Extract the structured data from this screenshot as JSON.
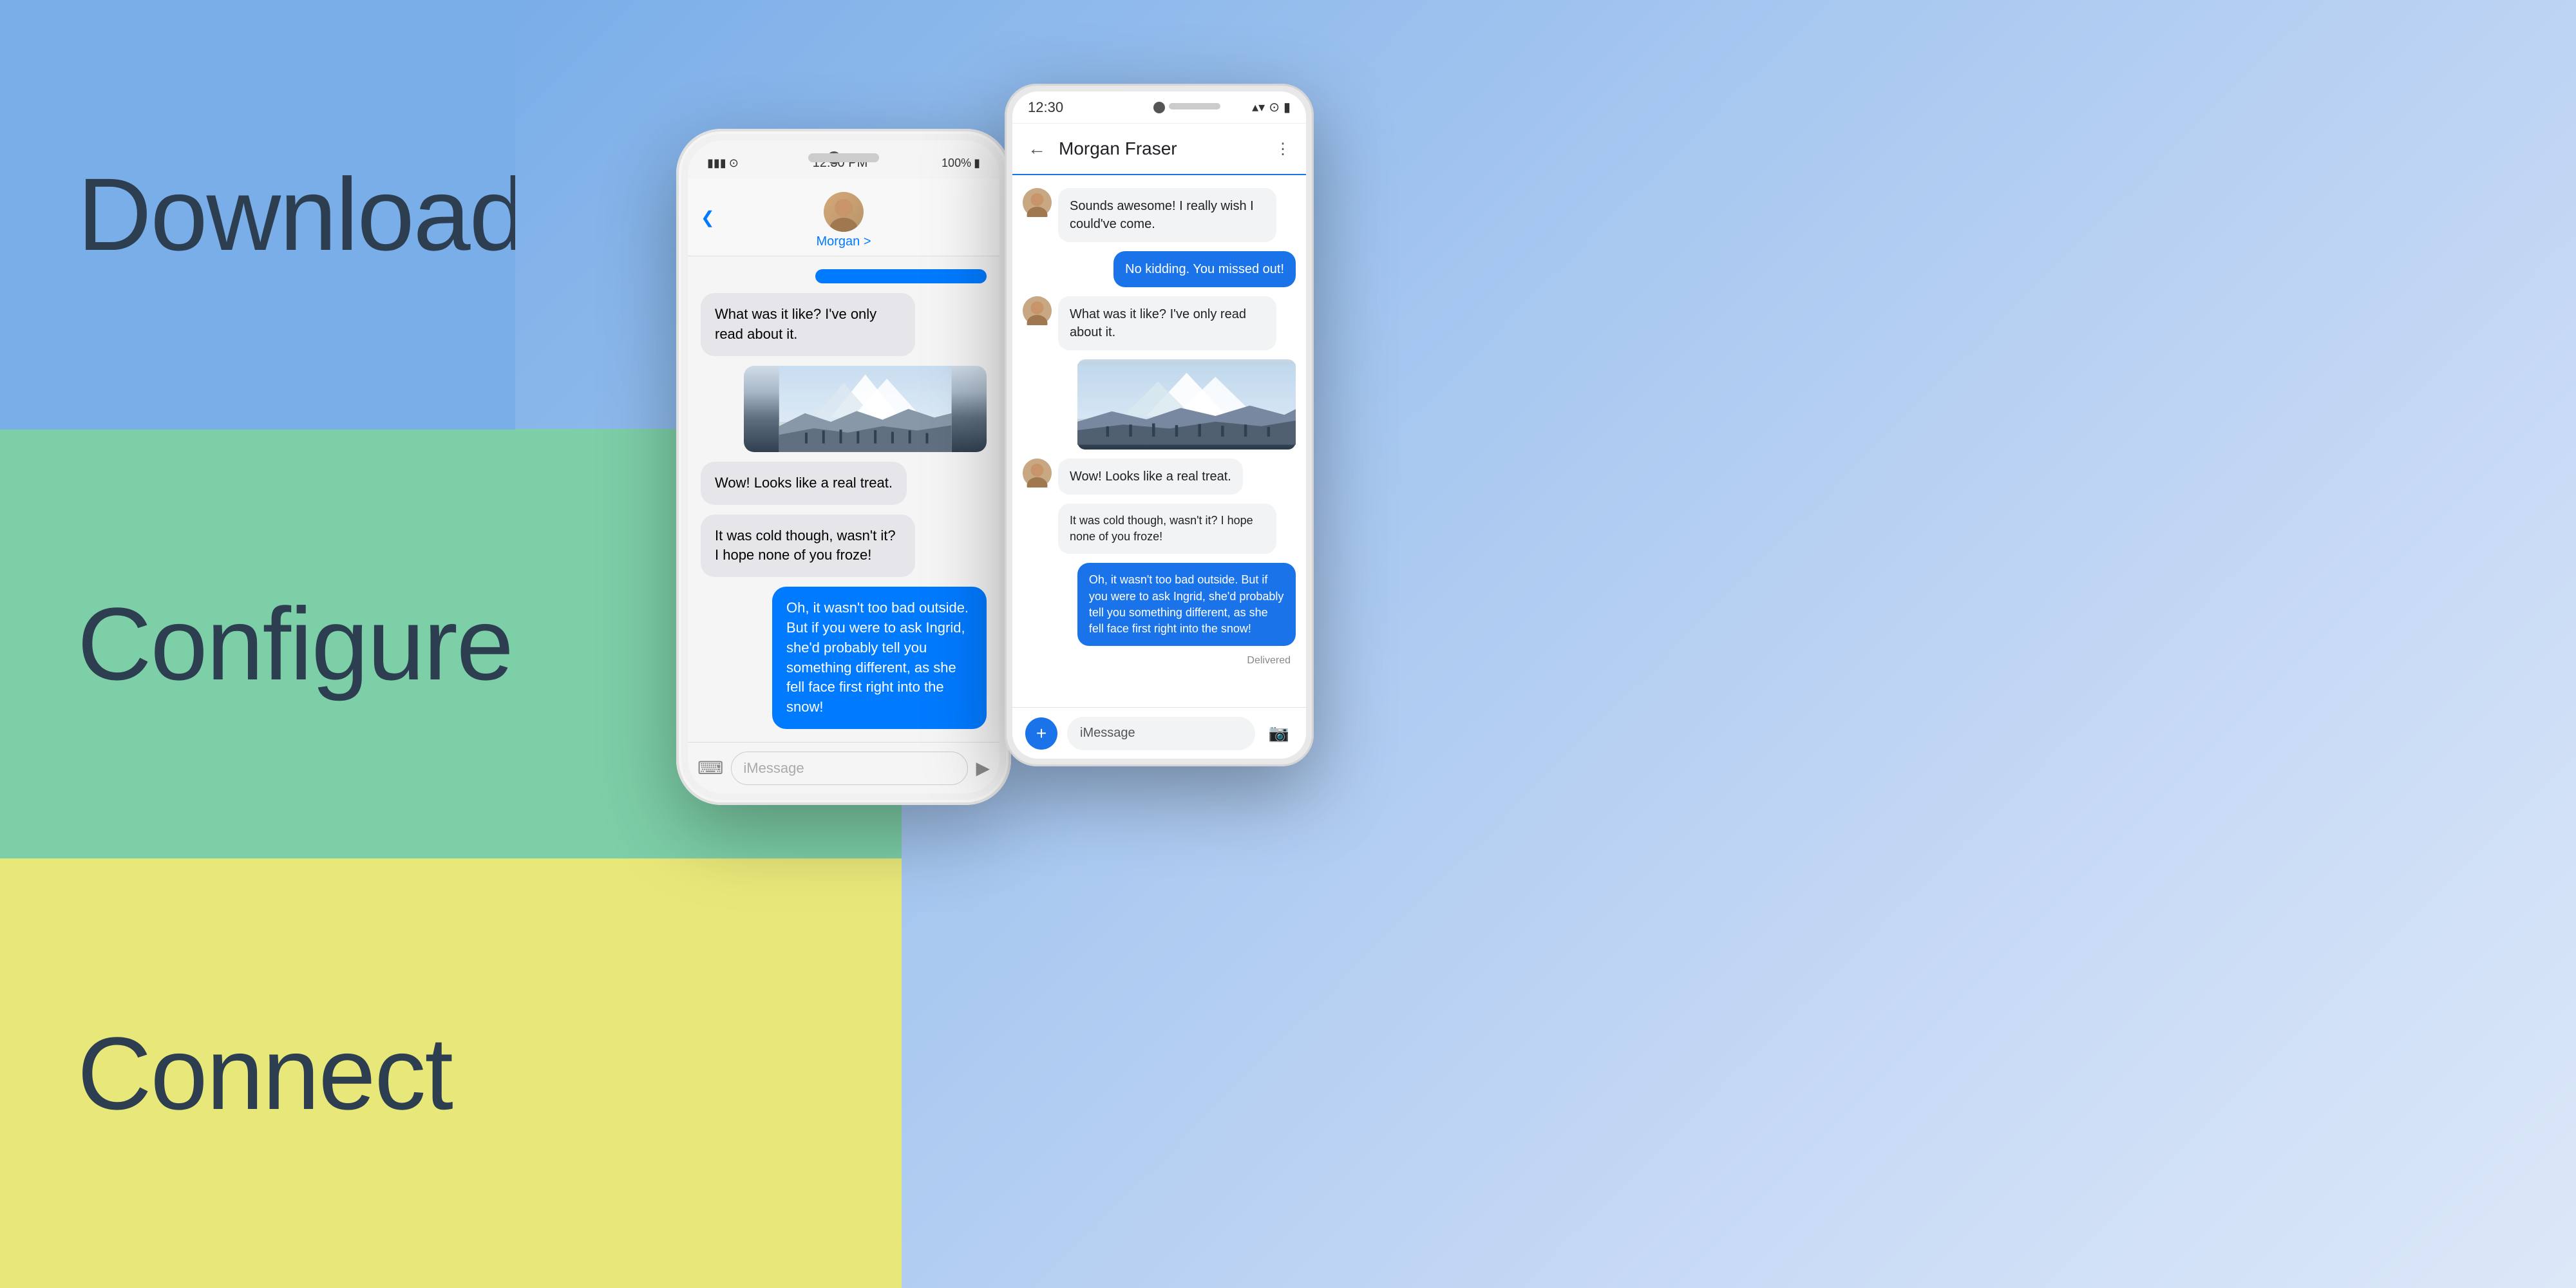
{
  "sections": [
    {
      "id": "download",
      "label": "Download",
      "bg": "#7aaee8"
    },
    {
      "id": "configure",
      "label": "Configure",
      "bg": "#7dcfa8"
    },
    {
      "id": "connect",
      "label": "Connect",
      "bg": "#e8e87a"
    }
  ],
  "iphone": {
    "status_time": "12:30 PM",
    "status_battery": "100%",
    "contact_name": "Morgan",
    "contact_name_full": "Morgan >",
    "messages": [
      {
        "type": "outgoing",
        "text": "[blue bar]"
      },
      {
        "type": "incoming",
        "text": "What was it like? I've only read about it."
      },
      {
        "type": "image"
      },
      {
        "type": "incoming",
        "text": "Wow! Looks like a real treat."
      },
      {
        "type": "incoming",
        "text": "It was cold though, wasn't it? I hope none of you froze!"
      },
      {
        "type": "outgoing",
        "text": "Oh, it wasn't too bad outside. But if you were to ask Ingrid, she'd probably tell you something different, as she fell face first right into the snow!"
      }
    ],
    "compose_placeholder": "iMessage"
  },
  "android": {
    "status_time": "12:30",
    "contact_name": "Morgan Fraser",
    "messages": [
      {
        "type": "incoming",
        "text": "Sounds awesome! I really wish I could've come."
      },
      {
        "type": "outgoing",
        "text": "No kidding. You missed out!"
      },
      {
        "type": "incoming",
        "text": "What was it like? I've only read about it."
      },
      {
        "type": "image"
      },
      {
        "type": "incoming",
        "text": "Wow! Looks like a real treat."
      },
      {
        "type": "incoming",
        "text": "It was cold though, wasn't it? I hope none of you froze!"
      },
      {
        "type": "outgoing",
        "text": "Oh, it wasn't too bad outside. But if you were to ask Ingrid, she'd probably tell you something different, as she fell face first right into the snow!"
      },
      {
        "type": "delivered",
        "text": "Delivered"
      }
    ],
    "compose_placeholder": "iMessage"
  }
}
